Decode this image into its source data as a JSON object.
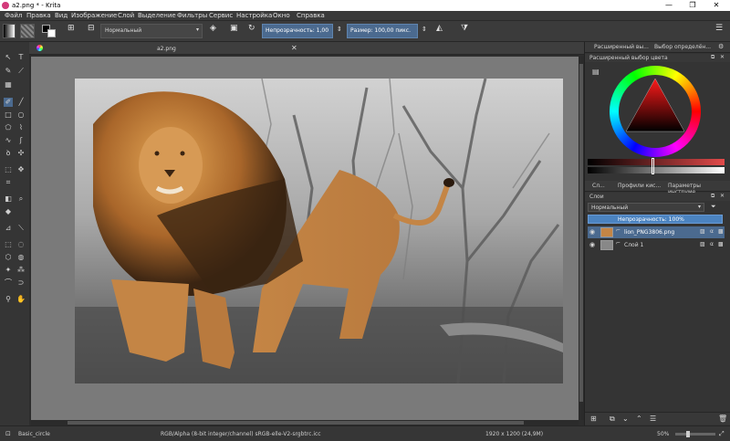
{
  "window": {
    "title": "a2.png * - Krita"
  },
  "menu": [
    "Файл",
    "Правка",
    "Вид",
    "Изображение",
    "Слой",
    "Выделение",
    "Фильтры",
    "Сервис",
    "Настройка",
    "Окно",
    "Справка"
  ],
  "toolbar": {
    "blend_mode": "Нормальный",
    "opacity_label": "Непрозрачность: 1,00",
    "size_label": "Размер: 100,00 пикс."
  },
  "document": {
    "tab_title": "a2.png"
  },
  "docker": {
    "tabs": [
      "Расширенный вы...",
      "Выбор определён..."
    ],
    "color_title": "Расширенный выбор цвета",
    "layer_tabs": [
      "Сл...",
      "Профили кис...",
      "Параметры инструме..."
    ],
    "layers_title": "Слои",
    "blend_mode": "Нормальный",
    "opacity": "Непрозрачность: 100%",
    "layers": [
      {
        "name": "lion_PNG3806.png",
        "selected": true
      },
      {
        "name": "Слой 1",
        "selected": false
      }
    ]
  },
  "status": {
    "brush": "Basic_circle",
    "color_space": "RGB/Alpha (8-bit integer/channel)  sRGB-elle-V2-srgbtrc.icc",
    "dimensions": "1920 x 1200 (24,9M)",
    "zoom": "50%"
  },
  "colors": {
    "accent": "#4b83c0",
    "bg": "#323232"
  }
}
